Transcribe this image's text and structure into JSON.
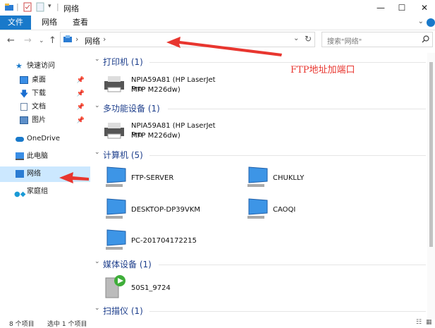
{
  "window": {
    "title": "网络",
    "minimize": "—",
    "maximize": "☐",
    "close": "✕"
  },
  "ribbon": {
    "tabs": [
      "文件",
      "网络",
      "查看"
    ]
  },
  "address": {
    "separator": "›",
    "location": "网络",
    "dropdown": "⌄",
    "refresh": "↻"
  },
  "search": {
    "placeholder": "搜索\"网络\""
  },
  "sidebar": {
    "items": [
      {
        "label": "快速访问",
        "icon": "star-icon",
        "pinned": false
      },
      {
        "label": "桌面",
        "icon": "desktop-icon",
        "pinned": true
      },
      {
        "label": "下载",
        "icon": "download-icon",
        "pinned": true
      },
      {
        "label": "文档",
        "icon": "document-icon",
        "pinned": true
      },
      {
        "label": "图片",
        "icon": "picture-icon",
        "pinned": true
      },
      {
        "label": "OneDrive",
        "icon": "cloud-icon",
        "pinned": false
      },
      {
        "label": "此电脑",
        "icon": "computer-icon",
        "pinned": false
      },
      {
        "label": "网络",
        "icon": "network-icon",
        "pinned": false,
        "selected": true
      },
      {
        "label": "家庭组",
        "icon": "homegroup-icon",
        "pinned": false
      }
    ]
  },
  "groups": {
    "printers": {
      "header": "打印机 (1)",
      "items": [
        {
          "line1": "NPIA59A81 (HP LaserJet Pro",
          "line2": "MFP M226dw)"
        }
      ]
    },
    "multifunction": {
      "header": "多功能设备 (1)",
      "items": [
        {
          "line1": "NPIA59A81 (HP LaserJet Pro",
          "line2": "MFP M226dw)"
        }
      ]
    },
    "computers": {
      "header": "计算机 (5)",
      "items": [
        "FTP-SERVER",
        "CHUKLLY",
        "DESKTOP-DP39VKM",
        "CAOQI",
        "PC-201704172215"
      ]
    },
    "media": {
      "header": "媒体设备 (1)",
      "items": [
        "50S1_9724"
      ]
    },
    "scanners": {
      "header": "扫描仪 (1)"
    }
  },
  "status": {
    "count": "8 个项目",
    "selected": "选中 1 个项目"
  },
  "annotation": "FTP地址加端口",
  "colors": {
    "accent": "#1979ca",
    "selection": "#cce8ff",
    "annotation": "#e8362f",
    "group_header": "#1e3f8c"
  }
}
